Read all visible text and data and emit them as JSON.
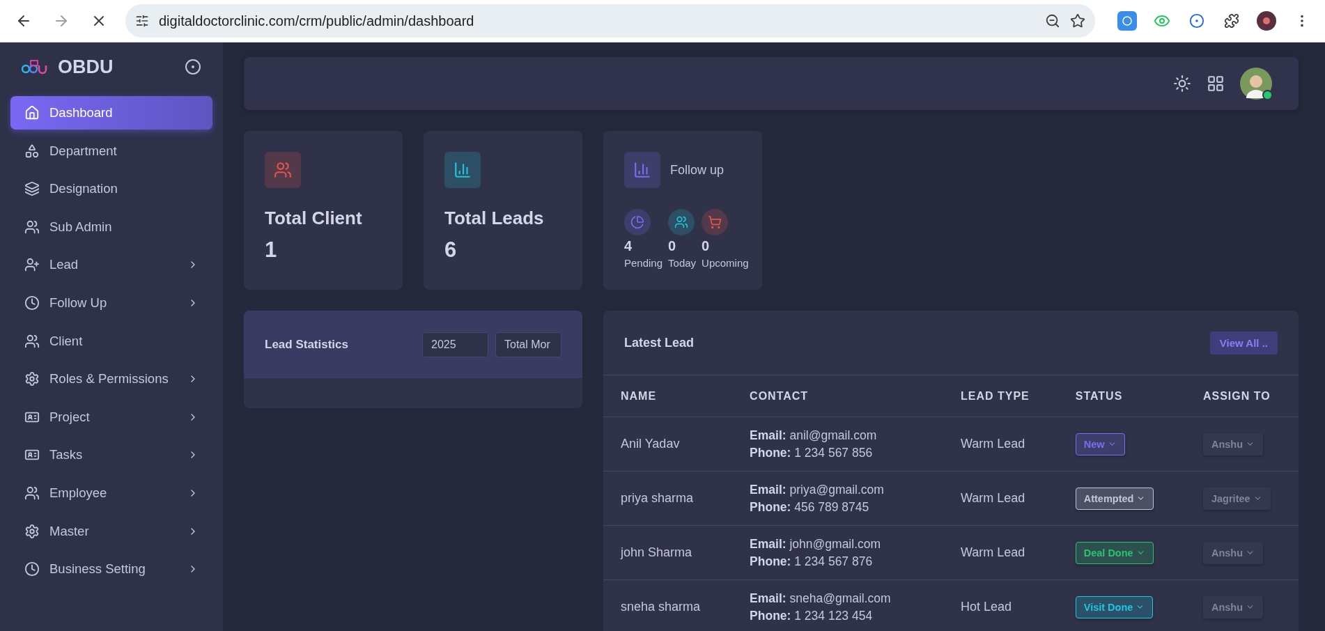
{
  "browser": {
    "url": "digitaldoctorclinic.com/crm/public/admin/dashboard"
  },
  "sidebar": {
    "brand": "OBDU",
    "items": [
      {
        "label": "Dashboard",
        "selected": true,
        "expandable": false
      },
      {
        "label": "Department",
        "selected": false,
        "expandable": false
      },
      {
        "label": "Designation",
        "selected": false,
        "expandable": false
      },
      {
        "label": "Sub Admin",
        "selected": false,
        "expandable": false
      },
      {
        "label": "Lead",
        "selected": false,
        "expandable": true
      },
      {
        "label": "Follow Up",
        "selected": false,
        "expandable": true
      },
      {
        "label": "Client",
        "selected": false,
        "expandable": false
      },
      {
        "label": "Roles & Permissions",
        "selected": false,
        "expandable": true
      },
      {
        "label": "Project",
        "selected": false,
        "expandable": true
      },
      {
        "label": "Tasks",
        "selected": false,
        "expandable": true
      },
      {
        "label": "Employee",
        "selected": false,
        "expandable": true
      },
      {
        "label": "Master",
        "selected": false,
        "expandable": true
      },
      {
        "label": "Business Setting",
        "selected": false,
        "expandable": true
      }
    ]
  },
  "topbar": {
    "user_online": true
  },
  "cards": [
    {
      "title": "Total Client",
      "value": "1",
      "color": "#e5534b"
    },
    {
      "title": "Total Leads",
      "value": "6",
      "color": "#22c5d8"
    }
  ],
  "follow_up": {
    "title": "Follow up",
    "color": "#7c6cf0",
    "stats": [
      {
        "value": "4",
        "label": "Pending",
        "color": "#7c6cf0"
      },
      {
        "value": "0",
        "label": "Today",
        "color": "#22c5d8"
      },
      {
        "value": "0",
        "label": "Upcoming",
        "color": "#e5534b"
      }
    ]
  },
  "lead_statistics": {
    "title": "Lead Statistics",
    "year": "2025",
    "period": "Total Mor"
  },
  "latest_lead": {
    "title": "Latest Lead",
    "view_all": "View All ..",
    "columns": [
      "NAME",
      "CONTACT",
      "LEAD TYPE",
      "STATUS",
      "ASSIGN TO"
    ],
    "rows": [
      {
        "name": "Anil Yadav",
        "contact": "**Email:** anil@gmail.com",
        "phone": "**Phone:** 1 234 567 856",
        "lead_type": "Warm Lead",
        "status": "New",
        "color": "#7c6cf0",
        "assign_to": "Anshu",
        "assign_disabled": true
      },
      {
        "name": "priya sharma",
        "contact": "**Email:** priya@gmail.com",
        "phone": "**Phone:** 456 789 8745",
        "lead_type": "Warm Lead",
        "status": "Attempted",
        "color": "#c3c6d4",
        "assign_to": "Jagritee",
        "assign_disabled": true
      },
      {
        "name": "john Sharma",
        "contact": "**Email:** john@gmail.com",
        "phone": "**Phone:** 1 234 567 876",
        "lead_type": "Warm Lead",
        "status": "Deal Done",
        "color": "#2bc46b",
        "assign_to": "Anshu",
        "assign_disabled": true
      },
      {
        "name": "sneha sharma",
        "contact": "**Email:** sneha@gmail.com",
        "phone": "**Phone:** 1 234 123 454",
        "lead_type": "Hot Lead",
        "status": "Visit Done",
        "color": "#1ec8e0",
        "assign_to": "Anshu",
        "assign_disabled": true
      }
    ]
  }
}
